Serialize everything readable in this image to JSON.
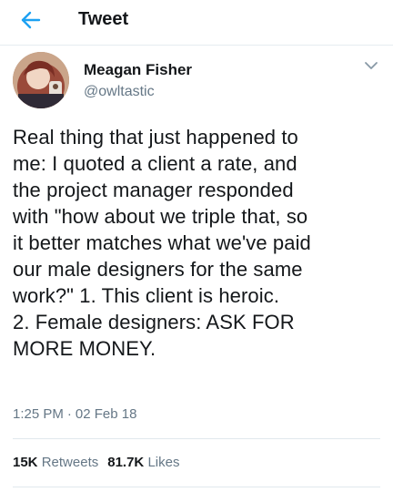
{
  "header": {
    "title": "Tweet",
    "back_icon": "arrow-left-icon"
  },
  "author": {
    "name": "Meagan Fisher",
    "handle": "@owltastic",
    "menu_icon": "chevron-down-icon"
  },
  "tweet": {
    "text": "Real thing that just happened to\nme: I quoted a client a rate, and\nthe project manager responded\nwith \"how about we triple that, so\nit better matches what we've paid\nour male designers for the same\nwork?\" 1. This client is heroic.\n2. Female designers: ASK FOR\nMORE MONEY.",
    "time": "1:25 PM",
    "separator": "·",
    "date": "02 Feb 18"
  },
  "stats": {
    "retweets_count": "15K",
    "retweets_label": "Retweets",
    "likes_count": "81.7K",
    "likes_label": "Likes"
  },
  "colors": {
    "accent": "#1da1f2",
    "secondary_text": "#657786",
    "primary_text": "#14171a"
  }
}
